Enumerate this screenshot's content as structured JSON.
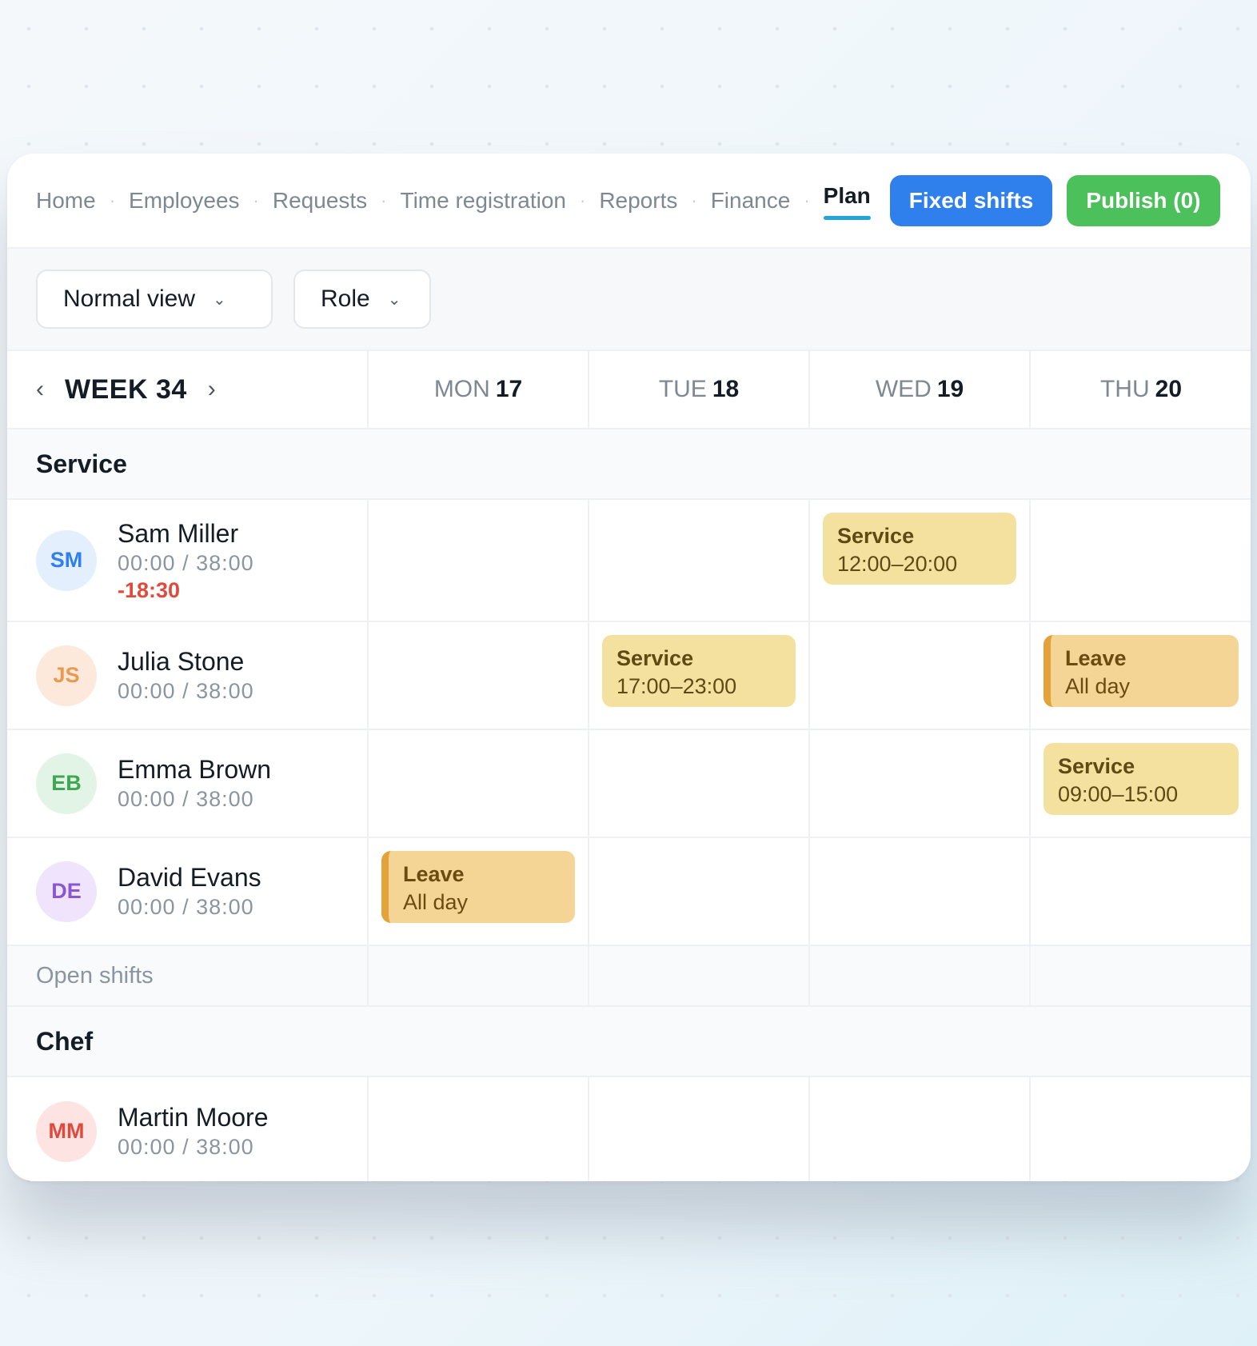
{
  "nav": {
    "items": [
      "Home",
      "Employees",
      "Requests",
      "Time registration",
      "Reports",
      "Finance",
      "Plan"
    ],
    "active": "Plan",
    "fixed_shifts_label": "Fixed shifts",
    "publish_label": "Publish (0)"
  },
  "filters": {
    "view_label": "Normal view",
    "role_label": "Role"
  },
  "week": {
    "prev_icon": "chevron-left-icon",
    "next_icon": "chevron-right-icon",
    "label": "WEEK 34",
    "days": [
      {
        "dow": "MON",
        "num": "17"
      },
      {
        "dow": "TUE",
        "num": "18"
      },
      {
        "dow": "WED",
        "num": "19"
      },
      {
        "dow": "THU",
        "num": "20"
      }
    ]
  },
  "groups": {
    "service": {
      "title": "Service",
      "employees": [
        {
          "initials": "SM",
          "name": "Sam Miller",
          "hours": "00:00 / 38:00",
          "diff": "-18:30",
          "avatar_bg": "#e3effc",
          "avatar_fg": "#2f80ed",
          "shifts": {
            "WED": {
              "type": "service",
              "title": "Service",
              "time": "12:00–20:00"
            }
          }
        },
        {
          "initials": "JS",
          "name": "Julia Stone",
          "hours": "00:00 / 38:00",
          "avatar_bg": "#fde8dc",
          "avatar_fg": "#e99a4c",
          "shifts": {
            "TUE": {
              "type": "service",
              "title": "Service",
              "time": "17:00–23:00"
            },
            "THU": {
              "type": "leave",
              "title": "Leave",
              "time": "All day"
            }
          }
        },
        {
          "initials": "EB",
          "name": "Emma Brown",
          "hours": "00:00 / 38:00",
          "avatar_bg": "#e2f4e6",
          "avatar_fg": "#3da84f",
          "shifts": {
            "THU": {
              "type": "service",
              "title": "Service",
              "time": "09:00–15:00"
            }
          }
        },
        {
          "initials": "DE",
          "name": "David Evans",
          "hours": "00:00 / 38:00",
          "avatar_bg": "#efe4fb",
          "avatar_fg": "#8a57d1",
          "shifts": {
            "MON": {
              "type": "leave",
              "title": "Leave",
              "time": "All day"
            }
          }
        }
      ],
      "open_shifts_label": "Open shifts"
    },
    "chef": {
      "title": "Chef",
      "employees": [
        {
          "initials": "MM",
          "name": "Martin Moore",
          "hours": "00:00 / 38:00",
          "avatar_bg": "#fde3e1",
          "avatar_fg": "#e04a3c",
          "shifts": {}
        }
      ]
    }
  }
}
